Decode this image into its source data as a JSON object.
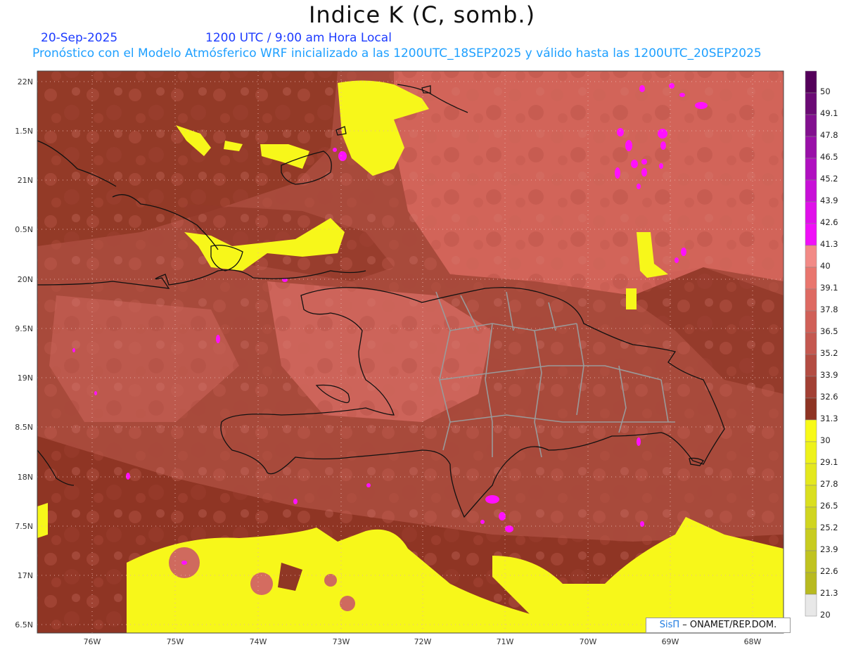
{
  "title": "Indice K (C, somb.)",
  "date": "20-Sep-2025",
  "time": "1200 UTC / 9:00 am Hora Local",
  "forecast_info": "Pronóstico con el Modelo Atmósferico WRF inicializado a las 1200UTC_18SEP2025 y válido hasta las  1200UTC_20SEP2025",
  "lat_labels": [
    "22N",
    "1.5N",
    "21N",
    "0.5N",
    "20N",
    "9.5N",
    "19N",
    "8.5N",
    "18N",
    "7.5N",
    "17N",
    "6.5N"
  ],
  "lon_labels": [
    "76W",
    "75W",
    "74W",
    "73W",
    "72W",
    "71W",
    "70W",
    "69W",
    "68W"
  ],
  "colorbar": {
    "labels": [
      "50",
      "49.1",
      "47.8",
      "46.5",
      "45.2",
      "43.9",
      "42.6",
      "41.3",
      "40",
      "39.1",
      "37.8",
      "36.5",
      "35.2",
      "33.9",
      "32.6",
      "31.3",
      "30",
      "29.1",
      "27.8",
      "26.5",
      "25.2",
      "23.9",
      "22.6",
      "21.3",
      "20"
    ],
    "colors": [
      "#54005a",
      "#6b0a75",
      "#82108f",
      "#9910a8",
      "#b010c0",
      "#c810d8",
      "#e010ea",
      "#f010f8",
      "#f28a86",
      "#e9766e",
      "#de6a62",
      "#d06058",
      "#c45850",
      "#b34c42",
      "#a24034",
      "#8e3423",
      "#f8fa18",
      "#eef21a",
      "#e4e81d",
      "#dadf1f",
      "#d0d520",
      "#c8cc20",
      "#c0c320",
      "#b8ba20",
      "#e8e8e8"
    ]
  },
  "credit": {
    "brand": "SisΠ",
    "org": "– ONAMET/REP.DOM."
  }
}
